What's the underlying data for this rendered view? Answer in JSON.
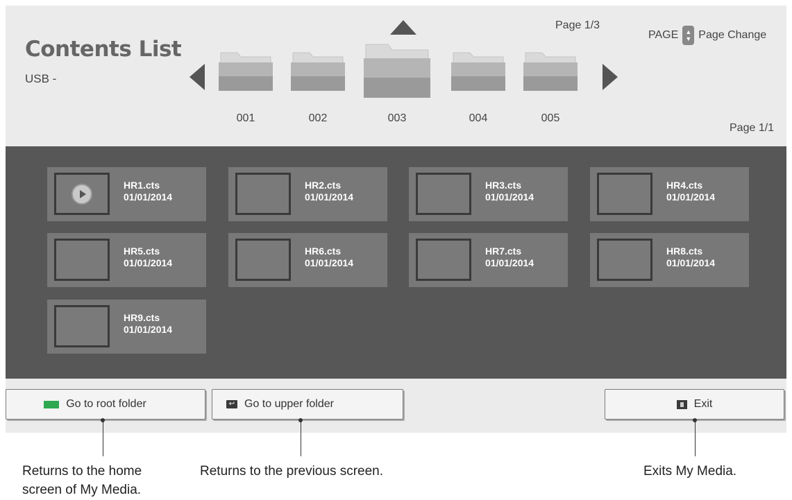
{
  "header": {
    "title": "Contents List",
    "source": "USB -",
    "folder_page": "Page 1/3",
    "page_key": "PAGE",
    "page_change_label": "Page Change",
    "content_page": "Page 1/1"
  },
  "folders": [
    {
      "label": "001"
    },
    {
      "label": "002"
    },
    {
      "label": "003",
      "selected": true
    },
    {
      "label": "004"
    },
    {
      "label": "005"
    }
  ],
  "files": [
    {
      "name": "HR1.cts",
      "date": "01/01/2014",
      "playing": true
    },
    {
      "name": "HR2.cts",
      "date": "01/01/2014"
    },
    {
      "name": "HR3.cts",
      "date": "01/01/2014"
    },
    {
      "name": "HR4.cts",
      "date": "01/01/2014"
    },
    {
      "name": "HR5.cts",
      "date": "01/01/2014"
    },
    {
      "name": "HR6.cts",
      "date": "01/01/2014"
    },
    {
      "name": "HR7.cts",
      "date": "01/01/2014"
    },
    {
      "name": "HR8.cts",
      "date": "01/01/2014"
    },
    {
      "name": "HR9.cts",
      "date": "01/01/2014"
    }
  ],
  "buttons": {
    "root": "Go to root folder",
    "upper": "Go to upper folder",
    "exit": "Exit"
  },
  "callouts": {
    "root_line1": "Returns to the home",
    "root_line2": "screen of My Media.",
    "upper": "Returns to the previous screen.",
    "exit": "Exits My Media."
  },
  "colors": {
    "root_key": "#2fa84f",
    "grid_bg": "#575757",
    "tile_bg": "#787878"
  }
}
